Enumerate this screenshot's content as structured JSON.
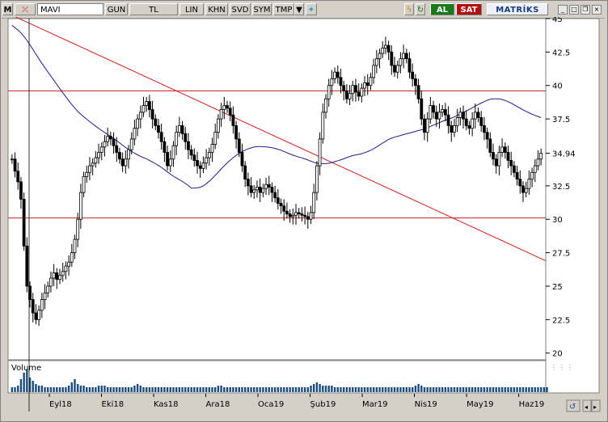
{
  "toolbar": {
    "m_label": "M",
    "symbol": "MAVI",
    "period": "GUN",
    "currency": "TL",
    "scale": "LIN",
    "btn_khn": "KHN",
    "btn_svd": "SVD",
    "btn_sym": "SYM",
    "btn_tmp": "TMP",
    "buy_label": "AL",
    "sell_label": "SAT",
    "brand": "MATRİKS"
  },
  "volume_label": "Volume",
  "last_price_label": "34.94",
  "colors": {
    "candle": "#000000",
    "ma_line": "#1c1c8c",
    "trend_line": "#cc2020",
    "volume": "#1a4c7c",
    "background": "#ffffff"
  },
  "chart_data": {
    "type": "candlestick",
    "title": "MAVI",
    "y_ticks": [
      20,
      22.5,
      25,
      27.5,
      30,
      32.5,
      34.94,
      37.5,
      40,
      42.5,
      45
    ],
    "x_ticks": [
      "Eyl18",
      "Eki18",
      "Kas18",
      "Ara18",
      "Oca19",
      "Şub19",
      "Mar19",
      "Nis19",
      "May19",
      "Haz19"
    ],
    "ylim": [
      19.5,
      45
    ],
    "horizontal_lines": [
      39.6,
      30.1
    ],
    "trend_line": {
      "start": 45.3,
      "end": 26.9
    },
    "last_value": 34.94,
    "close_series": [
      34.5,
      33.6,
      32.8,
      31.5,
      28.0,
      25.0,
      24.0,
      23.0,
      22.5,
      23.2,
      24.0,
      24.5,
      25.0,
      25.6,
      26.0,
      25.5,
      25.8,
      26.1,
      26.5,
      26.8,
      27.5,
      28.5,
      30.0,
      32.0,
      33.2,
      33.5,
      34.0,
      34.2,
      34.6,
      35.0,
      35.4,
      35.8,
      36.2,
      36.0,
      35.5,
      35.0,
      34.5,
      34.0,
      34.5,
      35.2,
      36.0,
      36.8,
      37.5,
      38.0,
      38.5,
      38.8,
      38.2,
      37.5,
      37.0,
      36.5,
      35.8,
      35.0,
      34.0,
      34.5,
      35.5,
      36.5,
      37.0,
      36.4,
      35.8,
      35.2,
      34.8,
      34.4,
      34.0,
      33.8,
      34.2,
      34.6,
      35.0,
      35.6,
      36.5,
      37.5,
      38.2,
      38.5,
      38.3,
      37.8,
      37.0,
      36.0,
      35.0,
      34.0,
      33.0,
      32.5,
      32.0,
      32.2,
      32.4,
      32.0,
      32.3,
      32.6,
      32.4,
      32.0,
      31.6,
      31.2,
      31.0,
      30.6,
      30.4,
      30.2,
      30.3,
      30.5,
      30.4,
      30.3,
      30.2,
      30.0,
      30.5,
      32.0,
      34.0,
      36.0,
      38.0,
      39.0,
      40.0,
      40.5,
      41.0,
      40.6,
      40.0,
      39.6,
      39.0,
      39.4,
      40.0,
      39.5,
      39.2,
      39.8,
      40.2,
      40.0,
      40.6,
      41.5,
      42.0,
      42.4,
      42.8,
      43.0,
      42.5,
      41.5,
      41.0,
      41.5,
      42.0,
      42.4,
      42.0,
      41.0,
      40.5,
      40.0,
      39.0,
      37.5,
      36.5,
      37.5,
      38.5,
      38.0,
      37.5,
      38.0,
      38.2,
      37.8,
      37.0,
      36.5,
      37.0,
      37.6,
      38.0,
      37.5,
      37.0,
      36.8,
      37.5,
      38.0,
      37.6,
      37.0,
      36.5,
      36.0,
      35.0,
      34.5,
      34.0,
      35.0,
      35.4,
      35.0,
      34.4,
      34.0,
      33.5,
      33.0,
      32.5,
      32.0,
      32.3,
      33.0,
      33.5,
      34.0,
      34.5,
      34.94
    ],
    "volume_series": [
      3,
      3,
      4,
      8,
      12,
      14,
      9,
      7,
      5,
      4,
      4,
      3,
      3,
      3,
      3,
      3,
      3,
      3,
      3,
      4,
      6,
      8,
      5,
      4,
      4,
      3,
      3,
      3,
      3,
      4,
      4,
      4,
      3,
      3,
      3,
      3,
      3,
      3,
      3,
      3,
      3,
      4,
      5,
      4,
      3,
      3,
      3,
      3,
      3,
      3,
      3,
      3,
      3,
      3,
      3,
      3,
      3,
      3,
      3,
      3,
      3,
      3,
      3,
      3,
      3,
      3,
      3,
      3,
      3,
      4,
      4,
      3,
      3,
      3,
      3,
      3,
      3,
      3,
      3,
      3,
      3,
      3,
      3,
      3,
      3,
      3,
      3,
      3,
      3,
      3,
      3,
      3,
      3,
      3,
      3,
      3,
      3,
      3,
      3,
      3,
      4,
      5,
      6,
      5,
      4,
      4,
      4,
      4,
      3,
      3,
      3,
      3,
      3,
      3,
      3,
      3,
      3,
      3,
      3,
      3,
      3,
      3,
      3,
      3,
      3,
      3,
      3,
      3,
      3,
      3,
      3,
      3,
      3,
      3,
      3,
      4,
      5,
      4,
      3,
      3,
      3,
      3,
      3,
      3,
      3,
      3,
      3,
      3,
      3,
      3,
      3,
      3,
      3,
      3,
      3,
      3,
      3,
      3,
      3,
      3,
      3,
      3,
      3,
      3,
      3,
      3,
      3,
      3,
      3,
      3,
      3,
      3,
      3,
      3,
      3,
      3,
      3,
      3,
      3,
      3
    ]
  }
}
